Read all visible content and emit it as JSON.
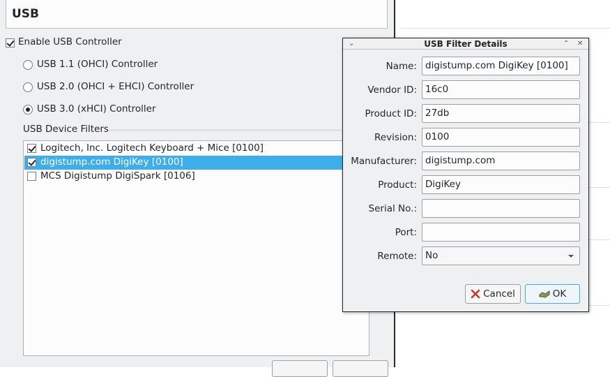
{
  "settings": {
    "title": "USB",
    "enable_controller": {
      "label": "Enable USB Controller",
      "checked": true
    },
    "controllers": [
      {
        "label": "USB 1.1 (OHCI) Controller",
        "selected": false
      },
      {
        "label": "USB 2.0 (OHCI + EHCI) Controller",
        "selected": false
      },
      {
        "label": "USB 3.0 (xHCI) Controller",
        "selected": true
      }
    ],
    "filters_title": "USB Device Filters",
    "filters": [
      {
        "label": "Logitech, Inc. Logitech Keyboard + Mice [0100]",
        "checked": true,
        "selected": false
      },
      {
        "label": "digistump.com DigiKey [0100]",
        "checked": true,
        "selected": true
      },
      {
        "label": "MCS Digistump DigiSpark [0106]",
        "checked": false,
        "selected": false
      }
    ]
  },
  "dialog": {
    "title": "USB Filter Details",
    "fields": {
      "name": {
        "label": "Name:",
        "value": "digistump.com DigiKey [0100]"
      },
      "vendor_id": {
        "label": "Vendor ID:",
        "value": "16c0"
      },
      "product_id": {
        "label": "Product ID:",
        "value": "27db"
      },
      "revision": {
        "label": "Revision:",
        "value": "0100"
      },
      "manufacturer": {
        "label": "Manufacturer:",
        "value": "digistump.com"
      },
      "product": {
        "label": "Product:",
        "value": "DigiKey"
      },
      "serial_no": {
        "label": "Serial No.:",
        "value": ""
      },
      "port": {
        "label": "Port:",
        "value": ""
      },
      "remote": {
        "label": "Remote:",
        "value": "No"
      }
    },
    "cancel_label": "Cancel",
    "ok_label": "OK"
  },
  "colors": {
    "selection": "#3daee9",
    "window_bg": "#eff0f1",
    "cancel_icon": "#c0392b",
    "ok_icon": "#4a5a2a"
  }
}
